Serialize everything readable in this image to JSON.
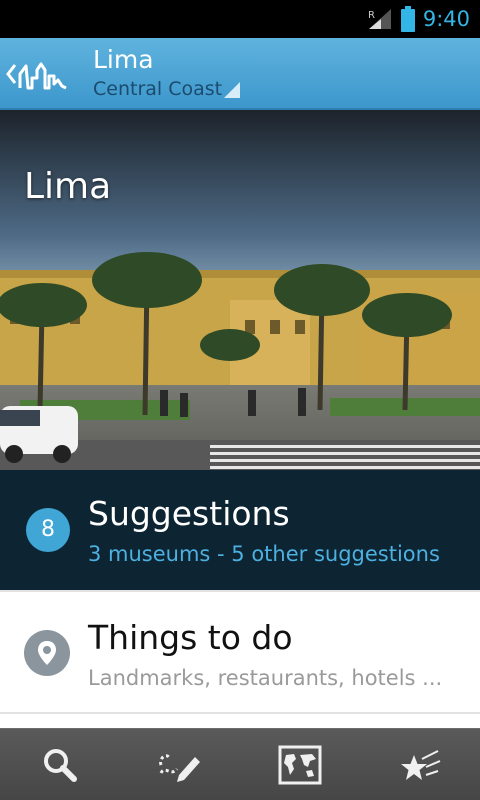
{
  "status_bar": {
    "time": "9:40",
    "network_label": "R"
  },
  "action_bar": {
    "title": "Lima",
    "subtitle": "Central Coast"
  },
  "hero": {
    "title": "Lima"
  },
  "suggestions": {
    "count": "8",
    "title": "Suggestions",
    "subtitle": "3 museums - 5 other suggestions"
  },
  "things_to_do": {
    "title": "Things to do",
    "subtitle": "Landmarks, restaurants, hotels ..."
  },
  "bottom_nav": [
    {
      "icon": "search-icon"
    },
    {
      "icon": "edit-route-icon"
    },
    {
      "icon": "world-map-icon"
    },
    {
      "icon": "favorites-stars-icon"
    }
  ],
  "colors": {
    "accent": "#33b5e5",
    "action_bar": "#4aa6d6",
    "suggestions_bg": "#0d2433",
    "suggestions_sub": "#4cb0e0"
  }
}
